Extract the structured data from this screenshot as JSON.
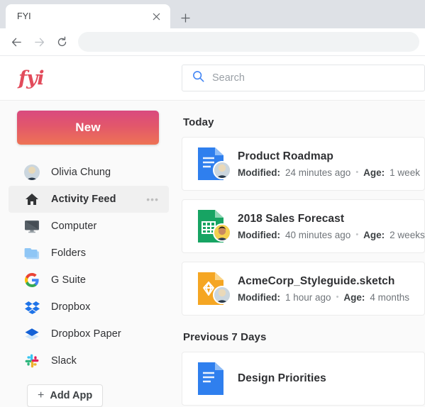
{
  "browser": {
    "tab_title": "FYI",
    "close_icon": "close-icon",
    "newtab_icon": "plus-icon",
    "back_icon": "arrow-left-icon",
    "forward_icon": "arrow-right-icon",
    "reload_icon": "reload-icon",
    "address_value": ""
  },
  "header": {
    "logo_text": "fyi",
    "logo_color": "#e24b5b",
    "search": {
      "icon": "search-icon",
      "placeholder": "Search",
      "value": "",
      "icon_color": "#4285f4"
    }
  },
  "sidebar": {
    "new_button": {
      "label": "New",
      "gradient_from": "#d94a7f",
      "gradient_to": "#ee7355"
    },
    "items": [
      {
        "label": "Olivia Chung",
        "icon": "user-avatar-icon",
        "active": false,
        "more": ""
      },
      {
        "label": "Activity Feed",
        "icon": "home-icon",
        "active": true,
        "more": "•••"
      },
      {
        "label": "Computer",
        "icon": "monitor-icon",
        "active": false,
        "more": ""
      },
      {
        "label": "Folders",
        "icon": "folder-icon",
        "active": false,
        "more": ""
      },
      {
        "label": "G Suite",
        "icon": "google-icon",
        "active": false,
        "more": ""
      },
      {
        "label": "Dropbox",
        "icon": "dropbox-icon",
        "active": false,
        "more": ""
      },
      {
        "label": "Dropbox Paper",
        "icon": "dropbox-paper-icon",
        "active": false,
        "more": ""
      },
      {
        "label": "Slack",
        "icon": "slack-icon",
        "active": false,
        "more": ""
      }
    ],
    "add_app": {
      "plus": "+",
      "label": "Add App"
    }
  },
  "feed": {
    "sections": [
      {
        "title": "Today",
        "files": [
          {
            "name": "Product Roadmap",
            "icon": "google-docs-file-icon",
            "icon_color": "#2f7fee",
            "modified_label": "Modified:",
            "modified_value": "24 minutes ago",
            "separator": "•",
            "age_label": "Age:",
            "age_value": "1 week",
            "avatar": "avatar-olivia"
          },
          {
            "name": "2018 Sales Forecast",
            "icon": "google-sheets-file-icon",
            "icon_color": "#17a463",
            "modified_label": "Modified:",
            "modified_value": "40 minutes ago",
            "separator": "•",
            "age_label": "Age:",
            "age_value": "2 weeks",
            "avatar": "avatar-male"
          },
          {
            "name": "AcmeCorp_Styleguide.sketch",
            "icon": "sketch-file-icon",
            "icon_color": "#f5a623",
            "modified_label": "Modified:",
            "modified_value": "1 hour ago",
            "separator": "•",
            "age_label": "Age:",
            "age_value": "4 months",
            "avatar": "avatar-olivia"
          }
        ]
      },
      {
        "title": "Previous 7 Days",
        "files": [
          {
            "name": "Design Priorities",
            "icon": "google-docs-file-icon",
            "icon_color": "#2f7fee",
            "modified_label": "",
            "modified_value": "",
            "separator": "",
            "age_label": "",
            "age_value": "",
            "avatar": ""
          }
        ]
      }
    ]
  }
}
